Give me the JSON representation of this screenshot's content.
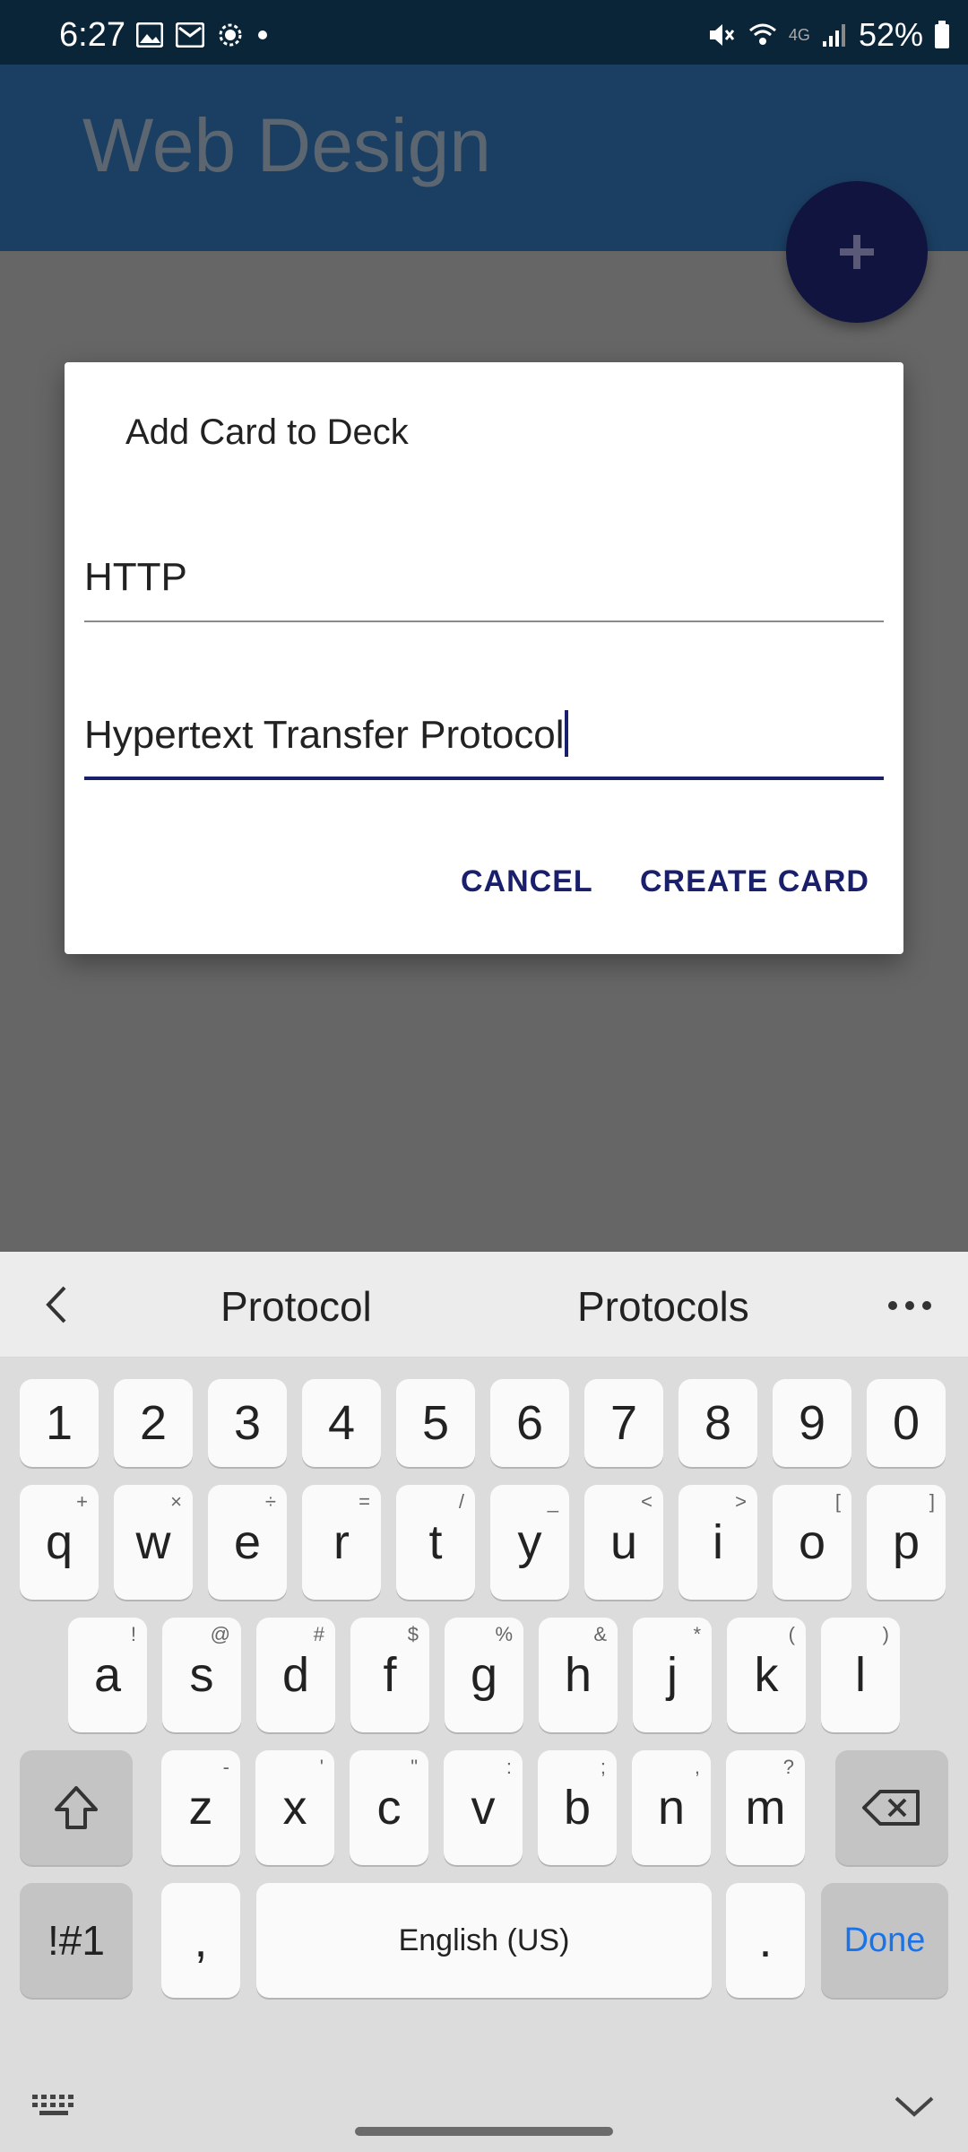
{
  "status_bar": {
    "time": "6:27",
    "battery": "52%",
    "network": "4G"
  },
  "app_bar": {
    "title": "Web Design",
    "fab_icon": "plus-icon"
  },
  "dialog": {
    "title": "Add Card to Deck",
    "front_value": "HTTP",
    "back_value": "Hypertext Transfer Protocol",
    "cancel_label": "CANCEL",
    "create_label": "CREATE CARD",
    "accent_color": "#1a1f6b"
  },
  "keyboard": {
    "suggestions": [
      "Protocol",
      "Protocols"
    ],
    "row_numbers": [
      "1",
      "2",
      "3",
      "4",
      "5",
      "6",
      "7",
      "8",
      "9",
      "0"
    ],
    "row1": [
      {
        "k": "q",
        "h": "+"
      },
      {
        "k": "w",
        "h": "×"
      },
      {
        "k": "e",
        "h": "÷"
      },
      {
        "k": "r",
        "h": "="
      },
      {
        "k": "t",
        "h": "/"
      },
      {
        "k": "y",
        "h": "_"
      },
      {
        "k": "u",
        "h": "<"
      },
      {
        "k": "i",
        "h": ">"
      },
      {
        "k": "o",
        "h": "["
      },
      {
        "k": "p",
        "h": "]"
      }
    ],
    "row2": [
      {
        "k": "a",
        "h": "!"
      },
      {
        "k": "s",
        "h": "@"
      },
      {
        "k": "d",
        "h": "#"
      },
      {
        "k": "f",
        "h": "$"
      },
      {
        "k": "g",
        "h": "%"
      },
      {
        "k": "h",
        "h": "&"
      },
      {
        "k": "j",
        "h": "*"
      },
      {
        "k": "k",
        "h": "("
      },
      {
        "k": "l",
        "h": ")"
      }
    ],
    "row3": [
      {
        "k": "z",
        "h": "-"
      },
      {
        "k": "x",
        "h": "'"
      },
      {
        "k": "c",
        "h": "\""
      },
      {
        "k": "v",
        "h": ":"
      },
      {
        "k": "b",
        "h": ";"
      },
      {
        "k": "n",
        "h": ","
      },
      {
        "k": "m",
        "h": "?"
      }
    ],
    "symbols_label": "!#1",
    "comma_label": ",",
    "space_label": "English (US)",
    "period_label": ".",
    "done_label": "Done",
    "done_color": "#1a73e8"
  }
}
